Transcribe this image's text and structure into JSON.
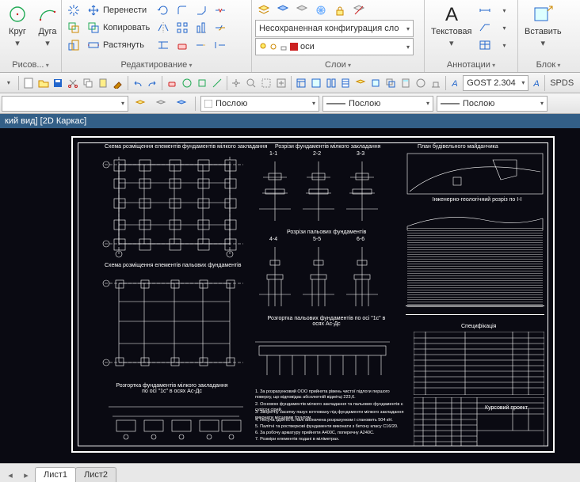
{
  "ribbon": {
    "draw": {
      "title": "Рисов...",
      "circle": "Круг",
      "arc": "Дуга"
    },
    "modify": {
      "title": "Редактирование",
      "move": "Перенести",
      "copy": "Копировать",
      "stretch": "Растянуть"
    },
    "layers": {
      "title": "Слои",
      "combo_label": "Несохраненная конфигурация сло",
      "current": "оси"
    },
    "annot": {
      "title": "Аннотации",
      "text": "Текстовая"
    },
    "block": {
      "title": "Блок",
      "insert": "Вставить"
    }
  },
  "qat": {
    "font_combo": "GOST 2.304",
    "spds": "SPDS"
  },
  "propbar": {
    "bylayer1": "Послою",
    "bylayer2": "Послою",
    "bylayer3": "Послою"
  },
  "doc": {
    "title": "кий вид] [2D Каркас]"
  },
  "drawing": {
    "t1": "Схема розміщення елементів фундаментів мілкого закладання",
    "t2": "Схема розміщення елементів пальових фундаментів",
    "t3": "Розгортка фундаментів мілкого закладання по осі \"1с\" в осях Ас-Дс",
    "t4": "Розрізи фундаментів мілкого закладання",
    "s11": "1-1",
    "s22": "2-2",
    "s33": "3-3",
    "t5": "Розрізи пальових фундаментів",
    "s44": "4-4",
    "s55": "5-5",
    "s66": "6-6",
    "t6": "Розгортка пальових фундаментів по осі \"1с\" в осях Ас-Дс",
    "t7": "План будівельного майданчика",
    "t8": "Інженерно-геологічний розріз по I-I",
    "t9": "Специфікація",
    "t10": "Курсовий проект",
    "note1": "1. За розрахунковий ООО прийнята рівень чистої підлоги першого поверху, що відповідає абсолютній відмітці 223,6.",
    "note2": "2. Основою фундаментів мілкого закладання та пальових фундаментів є супісок сірий.",
    "note3": "3. Зворотну засипку пазух котловану під фундаменти мілкого закладання виконати місцевим ґрунтом.",
    "note4": "4. Несуча здатність палі визначена розрахунком і становить 504 кН.",
    "note5": "5. Палітні та ростверкові фундаменти виконати з бетону класу С16/20.",
    "note6": "6. За робочу арматуру прийняти А400С, поперечну А240С.",
    "note7": "7. Розміри елементів подані в міліметрах."
  },
  "tabs": {
    "l1": "Лист1",
    "l2": "Лист2"
  }
}
